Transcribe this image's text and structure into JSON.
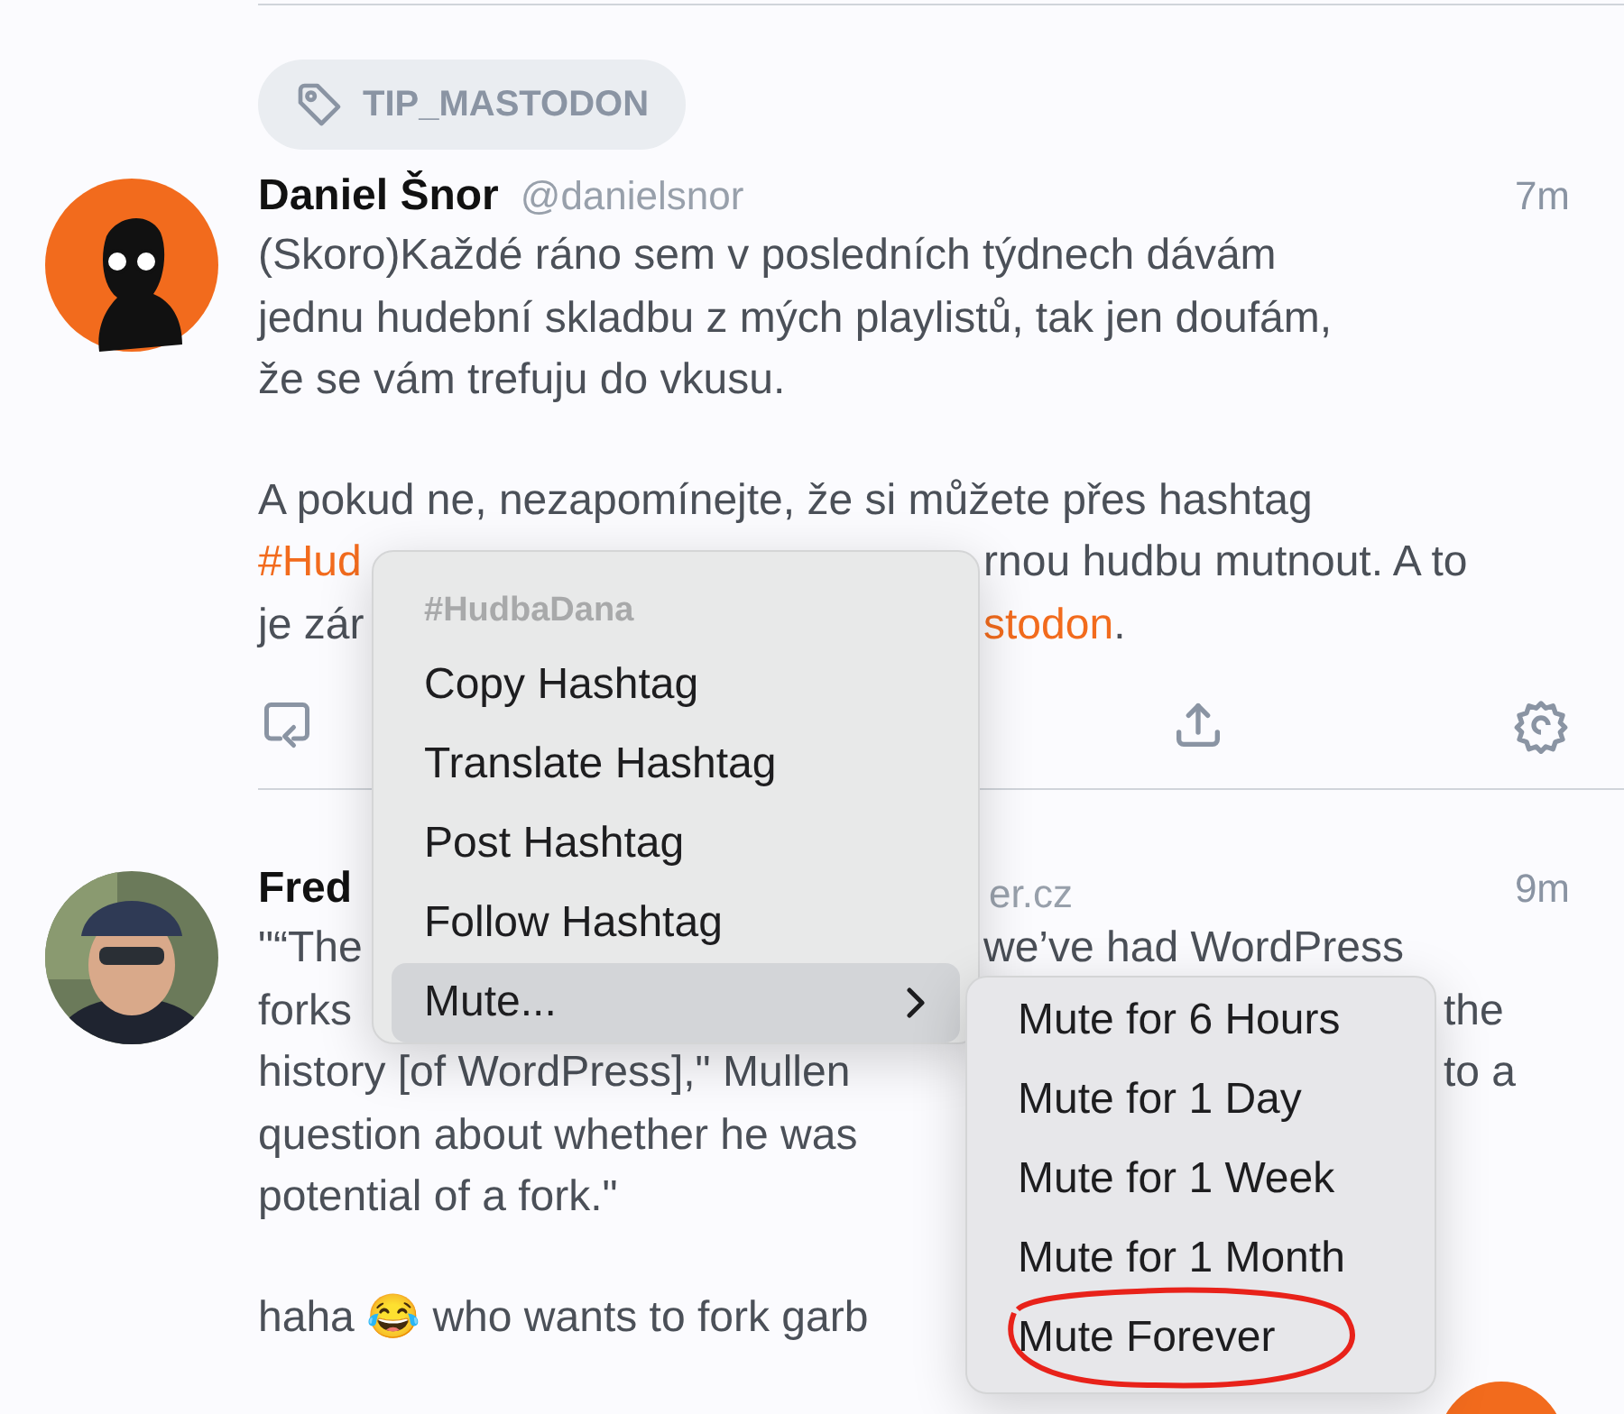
{
  "tag": {
    "label": "TIP_MASTODON"
  },
  "posts": [
    {
      "name": "Daniel Šnor",
      "handle": {
        "kind": "inline",
        "text": "@danielsnor"
      },
      "time": "7m",
      "avatar": {
        "kind": "illustration"
      },
      "actions": true,
      "lines": [
        {
          "kind": "text",
          "parts": [
            {
              "kind": "text",
              "text": "(Skoro)Každé ráno sem v posledních týdnech dávám"
            }
          ]
        },
        {
          "kind": "text",
          "parts": [
            {
              "kind": "text",
              "text": "jednu hudební skladbu z mých playlistů, tak jen doufám,"
            }
          ]
        },
        {
          "kind": "text",
          "parts": [
            {
              "kind": "text",
              "text": "že se vám trefuju do vkusu."
            }
          ]
        },
        {
          "kind": "blank"
        },
        {
          "kind": "text",
          "parts": [
            {
              "kind": "text",
              "text": "A pokud ne, nezapomínejte, že si můžete přes hashtag"
            }
          ]
        },
        {
          "kind": "text",
          "parts": [
            {
              "kind": "hashtag",
              "text": "#Hud"
            }
          ],
          "after": {
            "kind": "menu",
            "parts": [
              {
                "kind": "text",
                "text": "rnou hudbu mutnout. A to"
              }
            ]
          }
        },
        {
          "kind": "text",
          "parts": [
            {
              "kind": "text",
              "text": "je zár"
            }
          ],
          "after": {
            "kind": "menu",
            "parts": [
              {
                "kind": "hashtag",
                "text": "stodon"
              },
              {
                "kind": "text",
                "text": "."
              }
            ]
          }
        }
      ]
    },
    {
      "name": "Fred",
      "handle": {
        "kind": "after_menu",
        "text": "er.cz"
      },
      "time": "9m",
      "actions": false,
      "lines": [
        {
          "kind": "text",
          "parts": [
            {
              "kind": "text",
              "text": "\"“The"
            }
          ],
          "after": {
            "kind": "menu",
            "parts": [
              {
                "kind": "text",
                "text": "we’ve had WordPress"
              }
            ]
          }
        },
        {
          "kind": "text",
          "parts": [
            {
              "kind": "text",
              "text": "forks"
            }
          ],
          "after": {
            "kind": "submenu",
            "parts": [
              {
                "kind": "text",
                "text": "the"
              }
            ]
          }
        },
        {
          "kind": "text",
          "parts": [
            {
              "kind": "text",
              "text": "history [of WordPress],\" Mullen"
            }
          ],
          "after": {
            "kind": "submenu",
            "parts": [
              {
                "kind": "text",
                "text": "to a"
              }
            ]
          }
        },
        {
          "kind": "text",
          "parts": [
            {
              "kind": "text",
              "text": "question about whether he was"
            }
          ]
        },
        {
          "kind": "text",
          "parts": [
            {
              "kind": "text",
              "text": "potential of a fork.\""
            }
          ]
        },
        {
          "kind": "blank"
        },
        {
          "kind": "text",
          "parts": [
            {
              "kind": "text",
              "text": "haha 😂 who wants to fork garb"
            }
          ]
        }
      ]
    }
  ],
  "menu": {
    "header": "#HudbaDana",
    "items": [
      {
        "label": "Copy Hashtag",
        "selected": false,
        "submenu": false
      },
      {
        "label": "Translate Hashtag",
        "selected": false,
        "submenu": false
      },
      {
        "label": "Post Hashtag",
        "selected": false,
        "submenu": false
      },
      {
        "label": "Follow Hashtag",
        "selected": false,
        "submenu": false
      },
      {
        "label": "Mute...",
        "selected": true,
        "submenu": true
      }
    ]
  },
  "submenu": {
    "items": [
      {
        "label": "Mute for 6 Hours",
        "circled": false
      },
      {
        "label": "Mute for 1 Day",
        "circled": false
      },
      {
        "label": "Mute for 1 Week",
        "circled": false
      },
      {
        "label": "Mute for 1 Month",
        "circled": false
      },
      {
        "label": "Mute Forever",
        "circled": true
      }
    ]
  }
}
